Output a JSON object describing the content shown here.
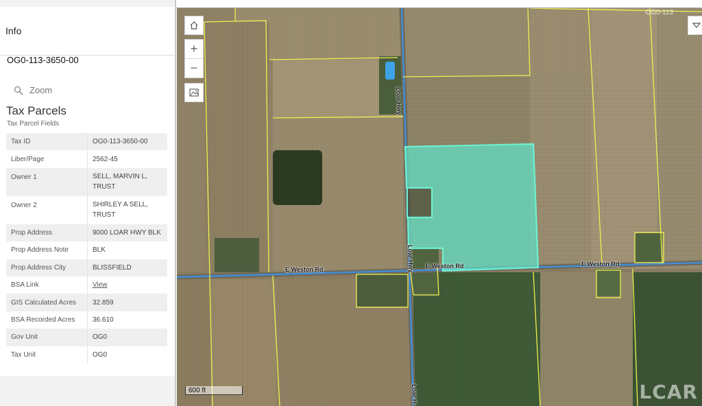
{
  "panel": {
    "title": "Info",
    "parcel_id": "OG0-113-3650-00",
    "zoom_label": "Zoom",
    "layer_title": "Tax Parcels",
    "layer_subtitle": "Tax Parcel Fields",
    "fields": [
      {
        "key": "Tax ID",
        "value": "OG0-113-3650-00"
      },
      {
        "key": "Liber/Page",
        "value": "2562-45"
      },
      {
        "key": "Owner 1",
        "value": "SELL, MARVIN L, TRUST"
      },
      {
        "key": "Owner 2",
        "value": "SHIRLEY A SELL, TRUST"
      },
      {
        "key": "Prop Address",
        "value": "9000 LOAR HWY BLK"
      },
      {
        "key": "Prop Address Note",
        "value": "BLK"
      },
      {
        "key": "Prop Address City",
        "value": "BLISSFIELD"
      },
      {
        "key": "BSA Link",
        "value": "View"
      },
      {
        "key": "GIS Calculated Acres",
        "value": "32.859"
      },
      {
        "key": "BSA Recorded Acres",
        "value": "36.610"
      },
      {
        "key": "Gov Unit",
        "value": "OG0"
      },
      {
        "key": "Tax Unit",
        "value": "OG0"
      }
    ]
  },
  "map": {
    "controls": {
      "home_icon": "home-icon",
      "zoom_in": "+",
      "zoom_out": "−",
      "basemap_icon": "image-icon",
      "menu_icon": "chevron-down-icon"
    },
    "road_labels": {
      "loar_hwy_north": "Loar Hwy",
      "loar_hwy_middle": "Loar Hwy",
      "loar_hwy_south": "Loar H",
      "weston_west": "E Weston Rd",
      "weston_middle": "E Weston Rd",
      "weston_east": "E Weston Rd"
    },
    "corner_label": "OG0-113",
    "scale_label": "600 ft",
    "watermark": "LCAR",
    "colors": {
      "parcel_lines": "#f0f050",
      "roads": "#3d8fe0",
      "selection_fill": "#5fe0c8",
      "selection_outline": "#6ff0d0"
    }
  }
}
